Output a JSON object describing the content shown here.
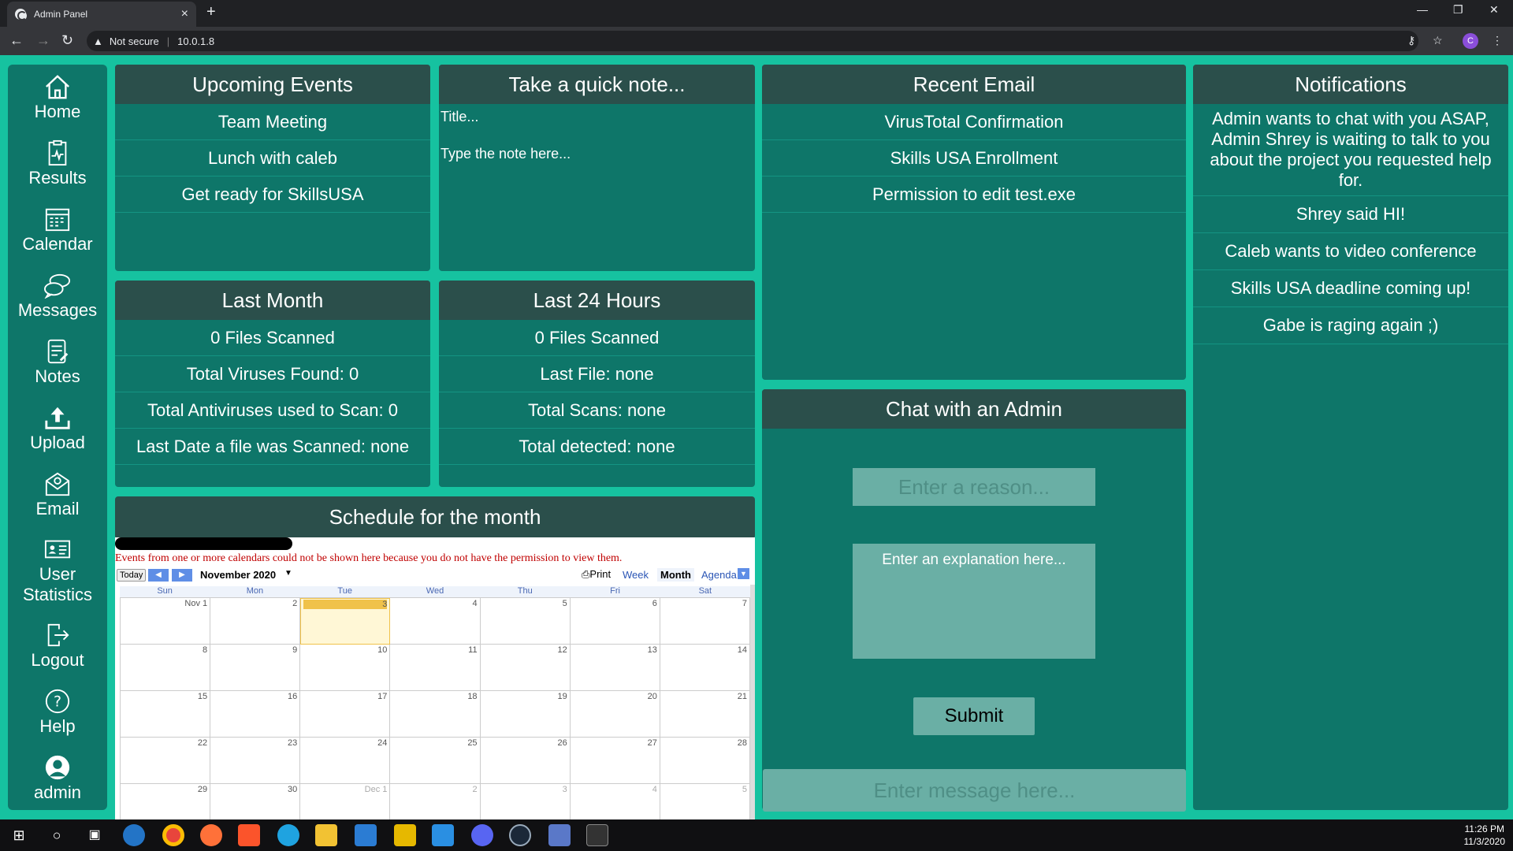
{
  "browser": {
    "tab_title": "Admin Panel",
    "new_tab": "+",
    "close_tab": "×",
    "security": "Not secure",
    "url": "10.0.1.8",
    "profile_initial": "C"
  },
  "sidebar": {
    "items": [
      {
        "label": "Home"
      },
      {
        "label": "Results"
      },
      {
        "label": "Calendar"
      },
      {
        "label": "Messages"
      },
      {
        "label": "Notes"
      },
      {
        "label": "Upload"
      },
      {
        "label": "Email"
      },
      {
        "label": "User Statistics"
      },
      {
        "label": "Logout"
      },
      {
        "label": "Help"
      },
      {
        "label": "admin"
      }
    ]
  },
  "upcoming_events": {
    "title": "Upcoming Events",
    "items": [
      "Team Meeting",
      "Lunch with caleb",
      "Get ready for SkillsUSA"
    ]
  },
  "quick_note": {
    "title": "Take a quick note...",
    "title_placeholder": "Title...",
    "body_placeholder": "Type the note here..."
  },
  "recent_email": {
    "title": "Recent Email",
    "items": [
      "VirusTotal Confirmation",
      "Skills USA Enrollment",
      "Permission to edit test.exe"
    ]
  },
  "notifications": {
    "title": "Notifications",
    "items": [
      "Admin wants to chat with you ASAP, Admin Shrey is waiting to talk to you about the project you requested help for.",
      "Shrey said HI!",
      "Caleb wants to video conference",
      "Skills USA deadline coming up!",
      "Gabe is raging again ;)"
    ]
  },
  "last_month": {
    "title": "Last Month",
    "items": [
      "0 Files Scanned",
      "Total Viruses Found: 0",
      "Total Antiviruses used to Scan: 0",
      "Last Date a file was Scanned: none"
    ]
  },
  "last_24": {
    "title": "Last 24 Hours",
    "items": [
      "0 Files Scanned",
      "Last File: none",
      "Total Scans: none",
      "Total detected: none"
    ]
  },
  "schedule": {
    "title": "Schedule for the month",
    "error": "Events from one or more calendars could not be shown here because you do not have the permission to view them.",
    "today_btn": "Today",
    "month": "November 2020",
    "print": "Print",
    "views": [
      "Week",
      "Month",
      "Agenda"
    ],
    "weekdays": [
      "Sun",
      "Mon",
      "Tue",
      "Wed",
      "Thu",
      "Fri",
      "Sat"
    ],
    "days": [
      "Nov 1",
      "2",
      "3",
      "4",
      "5",
      "6",
      "7",
      "8",
      "9",
      "10",
      "11",
      "12",
      "13",
      "14",
      "15",
      "16",
      "17",
      "18",
      "19",
      "20",
      "21",
      "22",
      "23",
      "24",
      "25",
      "26",
      "27",
      "28",
      "29",
      "30",
      "Dec 1",
      "2",
      "3",
      "4",
      "5"
    ]
  },
  "chat": {
    "title": "Chat with an Admin",
    "reason_placeholder": "Enter a reason...",
    "explanation_placeholder": "Enter an explanation here...",
    "submit": "Submit",
    "message_placeholder": "Enter message here..."
  },
  "taskbar": {
    "time": "11:26 PM",
    "date": "11/3/2020"
  },
  "colors": {
    "background": "#16c2a0",
    "panel": "#0e7669",
    "panel_header": "#2b4f4b",
    "input": "#6aafa5"
  }
}
